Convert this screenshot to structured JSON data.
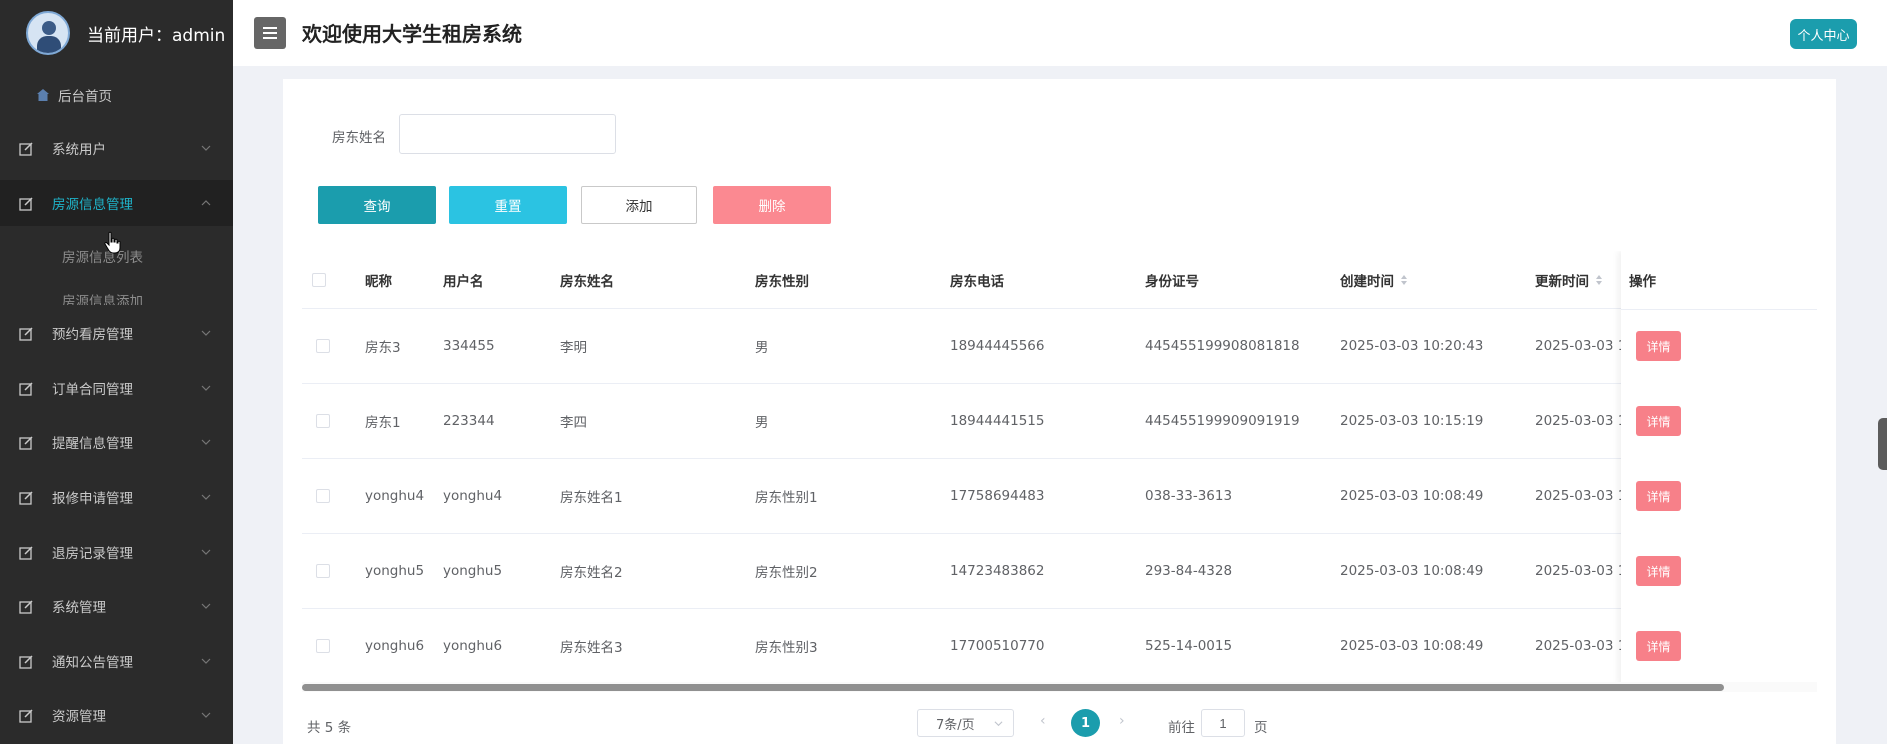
{
  "sidebar": {
    "user_label": "当前用户：admin",
    "home_label": "后台首页",
    "items": [
      {
        "label": "系统用户"
      },
      {
        "label": "房源信息管理",
        "active": true,
        "sub_items": [
          "房源信息列表",
          "房源信息添加"
        ]
      },
      {
        "label": "预约看房管理"
      },
      {
        "label": "订单合同管理"
      },
      {
        "label": "提醒信息管理"
      },
      {
        "label": "报修申请管理"
      },
      {
        "label": "退房记录管理"
      },
      {
        "label": "系统管理"
      },
      {
        "label": "通知公告管理"
      },
      {
        "label": "资源管理"
      }
    ]
  },
  "header": {
    "title": "欢迎使用大学生租房系统",
    "profile_button": "个人中心"
  },
  "search": {
    "label": "房东姓名",
    "value": ""
  },
  "toolbar": {
    "query": "查询",
    "reset": "重置",
    "add": "添加",
    "delete": "删除"
  },
  "table": {
    "columns": [
      "昵称",
      "用户名",
      "房东姓名",
      "房东性别",
      "房东电话",
      "身份证号",
      "创建时间",
      "更新时间",
      "操作"
    ],
    "rows": [
      {
        "nickname": "房东3",
        "username": "334455",
        "name": "李明",
        "gender": "男",
        "phone": "18944445566",
        "idcard": "445455199908081818",
        "created": "2025-03-03 10:20:43",
        "updated": "2025-03-03 1",
        "action": "详情"
      },
      {
        "nickname": "房东1",
        "username": "223344",
        "name": "李四",
        "gender": "男",
        "phone": "18944441515",
        "idcard": "445455199909091919",
        "created": "2025-03-03 10:15:19",
        "updated": "2025-03-03 1",
        "action": "详情"
      },
      {
        "nickname": "yonghu4",
        "username": "yonghu4",
        "name": "房东姓名1",
        "gender": "房东性别1",
        "phone": "17758694483",
        "idcard": "038-33-3613",
        "created": "2025-03-03 10:08:49",
        "updated": "2025-03-03 1",
        "action": "详情"
      },
      {
        "nickname": "yonghu5",
        "username": "yonghu5",
        "name": "房东姓名2",
        "gender": "房东性别2",
        "phone": "14723483862",
        "idcard": "293-84-4328",
        "created": "2025-03-03 10:08:49",
        "updated": "2025-03-03 1",
        "action": "详情"
      },
      {
        "nickname": "yonghu6",
        "username": "yonghu6",
        "name": "房东姓名3",
        "gender": "房东性别3",
        "phone": "17700510770",
        "idcard": "525-14-0015",
        "created": "2025-03-03 10:08:49",
        "updated": "2025-03-03 1",
        "action": "详情"
      }
    ]
  },
  "pagination": {
    "total": "共 5 条",
    "page_size": "7条/页",
    "current_page": "1",
    "goto_label": "前往",
    "goto_value": "1",
    "goto_suffix": "页"
  },
  "colors": {
    "accent": "#1b9dad",
    "sidebar_bg": "#2b2b2b",
    "active_text": "#1fb3c9",
    "danger": "#fb8991"
  }
}
